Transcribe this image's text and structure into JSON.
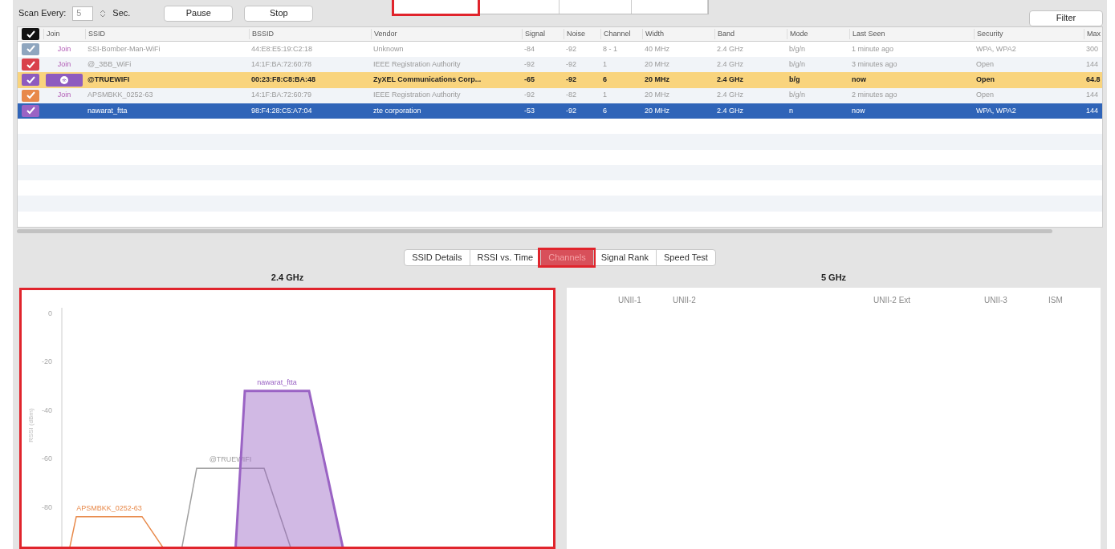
{
  "toolbar": {
    "scan_label": "Scan Every:",
    "interval": "5",
    "unit": "Sec.",
    "buttons": [
      "Pause",
      "Stop"
    ],
    "filter": "Filter",
    "top_control_highlighted": true
  },
  "table": {
    "join_header": "Join",
    "columns": [
      "SSID",
      "BSSID",
      "Vendor",
      "Signal",
      "Noise",
      "Channel",
      "Width",
      "Band",
      "Mode",
      "Last Seen",
      "Security",
      "Max"
    ],
    "all_checked": true,
    "rows": [
      {
        "checked": true,
        "color": "#8fa6bf",
        "join": "Join",
        "connected": false,
        "highlighted": false,
        "selected": false,
        "cells": [
          "SSI-Bomber-Man-WiFi",
          "44:E8:E5:19:C2:18",
          "Unknown",
          "-84",
          "-92",
          "8 - 1",
          "40 MHz",
          "2.4 GHz",
          "b/g/n",
          "1 minute ago",
          "WPA, WPA2",
          "300"
        ]
      },
      {
        "checked": true,
        "color": "#d9404a",
        "join": "Join",
        "connected": false,
        "highlighted": false,
        "selected": false,
        "cells": [
          "@_3BB_WiFi",
          "14:1F:BA:72:60:78",
          "IEEE Registration Authority",
          "-92",
          "-92",
          "1",
          "20 MHz",
          "2.4 GHz",
          "b/g/n",
          "3 minutes ago",
          "Open",
          "144"
        ]
      },
      {
        "checked": true,
        "color": "#8e5bbf",
        "connected": true,
        "highlighted": true,
        "selected": false,
        "cells": [
          "@TRUEWIFI",
          "00:23:F8:C8:BA:48",
          "ZyXEL Communications Corp...",
          "-65",
          "-92",
          "6",
          "20 MHz",
          "2.4 GHz",
          "b/g",
          "now",
          "Open",
          "64.8"
        ]
      },
      {
        "checked": true,
        "color": "#e8894a",
        "join": "Join",
        "connected": false,
        "highlighted": false,
        "selected": false,
        "cells": [
          "APSMBKK_0252-63",
          "14:1F:BA:72:60:79",
          "IEEE Registration Authority",
          "-92",
          "-82",
          "1",
          "20 MHz",
          "2.4 GHz",
          "b/g/n",
          "2 minutes ago",
          "Open",
          "144"
        ]
      },
      {
        "checked": true,
        "color": "#9a63c4",
        "connected": false,
        "highlighted": false,
        "selected": true,
        "cells": [
          "nawarat_ftta",
          "98:F4:28:C5:A7:04",
          "zte corporation",
          "-53",
          "-92",
          "6",
          "20 MHz",
          "2.4 GHz",
          "n",
          "now",
          "WPA, WPA2",
          "144"
        ]
      }
    ]
  },
  "tabs": [
    {
      "label": "SSID Details",
      "selected": false
    },
    {
      "label": "RSSI vs. Time",
      "selected": false
    },
    {
      "label": "Channels",
      "selected": true
    },
    {
      "label": "Signal Rank",
      "selected": false
    },
    {
      "label": "Speed Test",
      "selected": false
    }
  ],
  "panel_24": {
    "title": "2.4 GHz",
    "highlighted": true,
    "y_label": "RSSI (dBm)",
    "y_ticks": [
      "0",
      "-20",
      "-40",
      "-60",
      "-80"
    ],
    "networks": [
      {
        "label": "APSMBKK_0252-63",
        "color": "#e8894a",
        "fill": false
      },
      {
        "label": "@TRUEWIFI",
        "color": "#a0a0a0",
        "fill": false
      },
      {
        "label": "nawarat_ftta",
        "color": "#9a63c4",
        "fill": true
      }
    ]
  },
  "panel_5": {
    "title": "5 GHz",
    "bands": [
      "UNII-1",
      "UNII-2",
      "UNII-2 Ext",
      "UNII-3",
      "ISM"
    ]
  }
}
